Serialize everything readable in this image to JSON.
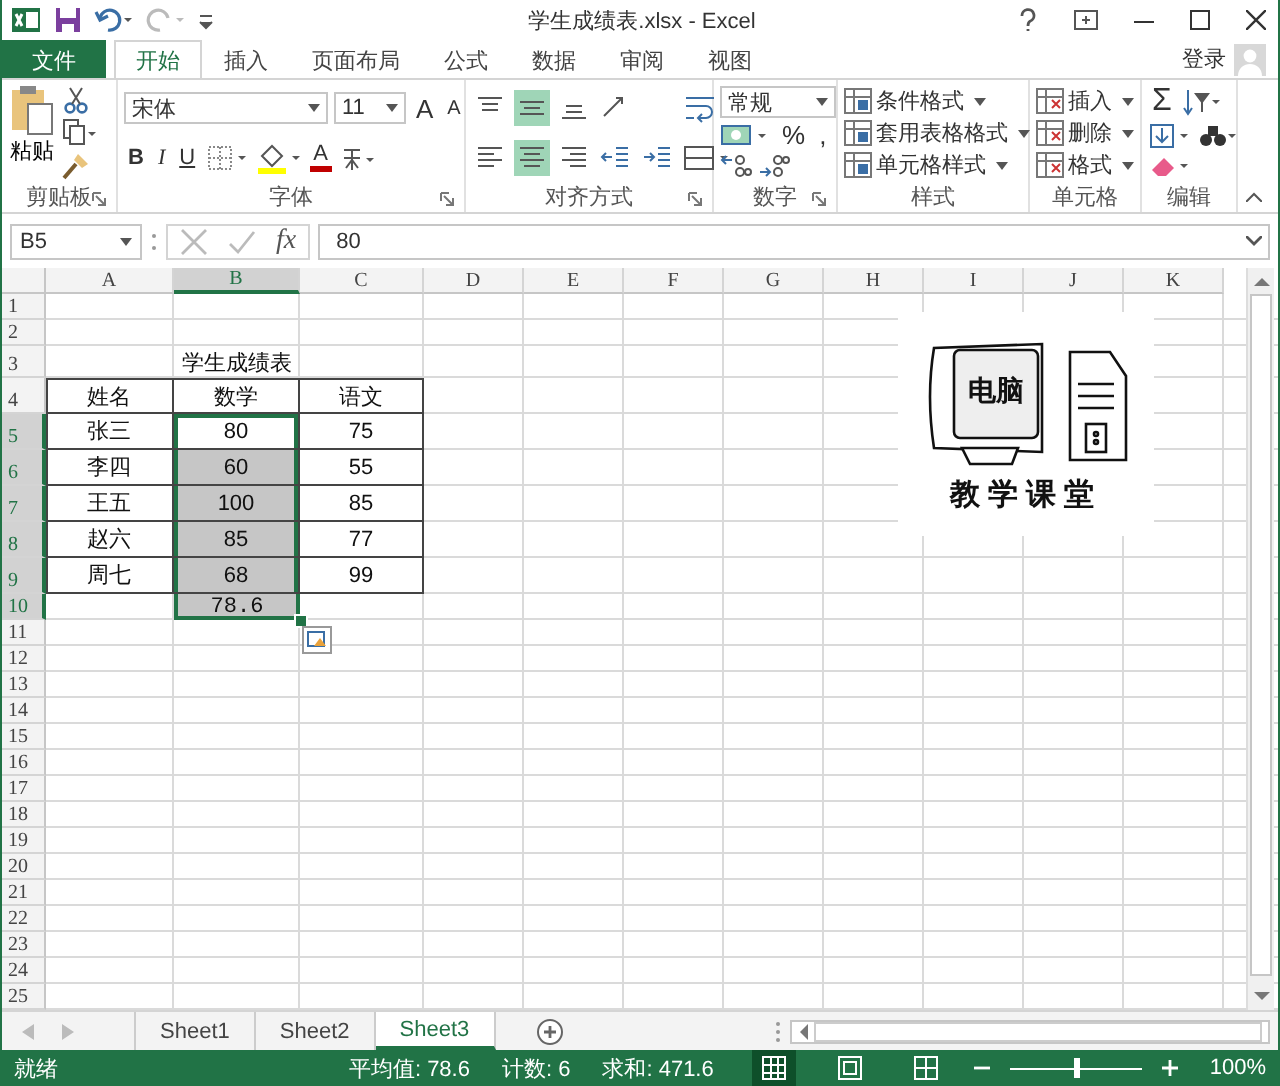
{
  "window": {
    "title": "学生成绩表.xlsx - Excel",
    "sign_in": "登录"
  },
  "ribbon_tabs": [
    {
      "label": "文件",
      "kind": "file",
      "selected": false
    },
    {
      "label": "开始",
      "kind": "tab",
      "selected": true
    },
    {
      "label": "插入",
      "kind": "tab",
      "selected": false
    },
    {
      "label": "页面布局",
      "kind": "tab",
      "selected": false
    },
    {
      "label": "公式",
      "kind": "tab",
      "selected": false
    },
    {
      "label": "数据",
      "kind": "tab",
      "selected": false
    },
    {
      "label": "审阅",
      "kind": "tab",
      "selected": false
    },
    {
      "label": "视图",
      "kind": "tab",
      "selected": false
    }
  ],
  "ribbon_groups": [
    {
      "name": "剪贴板",
      "kind": "clipboard",
      "paste": "粘贴"
    },
    {
      "name": "字体",
      "kind": "font",
      "font": "宋体",
      "size": "11",
      "grow": "A",
      "shrink": "A",
      "bold": "B",
      "italic": "I",
      "underline": "U",
      "font_color": "A"
    },
    {
      "name": "对齐方式",
      "kind": "alignment",
      "buttons": [
        {
          "kind": "top",
          "on": false
        },
        {
          "kind": "middle",
          "on": true
        },
        {
          "kind": "bottom",
          "on": false
        },
        {
          "kind": "orientation",
          "on": false
        },
        {
          "kind": "left",
          "on": false
        },
        {
          "kind": "center",
          "on": true
        },
        {
          "kind": "right",
          "on": false
        },
        {
          "kind": "outdent",
          "on": false
        },
        {
          "kind": "indent",
          "on": false
        }
      ]
    },
    {
      "name": "数字",
      "kind": "number",
      "format": "常规",
      "percent": "%",
      "comma": ","
    },
    {
      "name": "样式",
      "kind": "styles",
      "items": [
        "条件格式",
        "套用表格格式",
        "单元格样式"
      ]
    },
    {
      "name": "单元格",
      "kind": "cells",
      "items": [
        "插入",
        "删除",
        "格式"
      ]
    },
    {
      "name": "编辑",
      "kind": "editing",
      "sum": "Σ"
    }
  ],
  "formula_bar": {
    "name_box": "B5",
    "function": "fx",
    "value": "80"
  },
  "columns": [
    {
      "label": "A",
      "selected": false
    },
    {
      "label": "B",
      "selected": true
    },
    {
      "label": "C",
      "selected": false
    },
    {
      "label": "D",
      "selected": false
    },
    {
      "label": "E",
      "selected": false
    },
    {
      "label": "F",
      "selected": false
    },
    {
      "label": "G",
      "selected": false
    },
    {
      "label": "H",
      "selected": false
    },
    {
      "label": "I",
      "selected": false
    },
    {
      "label": "J",
      "selected": false
    },
    {
      "label": "K",
      "selected": false
    }
  ],
  "rows": [
    {
      "label": "1",
      "selected": false
    },
    {
      "label": "2",
      "selected": false
    },
    {
      "label": "3",
      "selected": false
    },
    {
      "label": "4",
      "selected": false
    },
    {
      "label": "5",
      "selected": true
    },
    {
      "label": "6",
      "selected": true
    },
    {
      "label": "7",
      "selected": true
    },
    {
      "label": "8",
      "selected": true
    },
    {
      "label": "9",
      "selected": true
    },
    {
      "label": "10",
      "selected": true
    },
    {
      "label": "11",
      "selected": false
    },
    {
      "label": "12",
      "selected": false
    },
    {
      "label": "13",
      "selected": false
    },
    {
      "label": "14",
      "selected": false
    },
    {
      "label": "15",
      "selected": false
    },
    {
      "label": "16",
      "selected": false
    },
    {
      "label": "17",
      "selected": false
    },
    {
      "label": "18",
      "selected": false
    },
    {
      "label": "19",
      "selected": false
    },
    {
      "label": "20",
      "selected": false
    },
    {
      "label": "21",
      "selected": false
    },
    {
      "label": "22",
      "selected": false
    },
    {
      "label": "23",
      "selected": false
    },
    {
      "label": "24",
      "selected": false
    },
    {
      "label": "25",
      "selected": false
    }
  ],
  "table": {
    "title": "学生成绩表",
    "header": [
      "姓名",
      "数学",
      "语文"
    ],
    "rows": [
      {
        "cells": [
          {
            "text": "张三",
            "selected": false
          },
          {
            "text": "80",
            "selected": true,
            "active": true
          },
          {
            "text": "75",
            "selected": false
          }
        ]
      },
      {
        "cells": [
          {
            "text": "李四",
            "selected": false
          },
          {
            "text": "60",
            "selected": true,
            "active": false
          },
          {
            "text": "55",
            "selected": false
          }
        ]
      },
      {
        "cells": [
          {
            "text": "王五",
            "selected": false
          },
          {
            "text": "100",
            "selected": true,
            "active": false
          },
          {
            "text": "85",
            "selected": false
          }
        ]
      },
      {
        "cells": [
          {
            "text": "赵六",
            "selected": false
          },
          {
            "text": "85",
            "selected": true,
            "active": false
          },
          {
            "text": "77",
            "selected": false
          }
        ]
      },
      {
        "cells": [
          {
            "text": "周七",
            "selected": false
          },
          {
            "text": "68",
            "selected": true,
            "active": false
          },
          {
            "text": "99",
            "selected": false
          }
        ]
      }
    ],
    "average": {
      "text": "78.6",
      "selected": true,
      "active": false
    }
  },
  "picture": {
    "screen_text": "电脑",
    "caption": "教学课堂"
  },
  "sheet_tabs": [
    {
      "label": "Sheet1",
      "selected": false
    },
    {
      "label": "Sheet2",
      "selected": false
    },
    {
      "label": "Sheet3",
      "selected": true
    }
  ],
  "status_bar": {
    "status": "就绪",
    "average": "平均值: 78.6",
    "count": "计数: 6",
    "sum": "求和: 471.6",
    "views": [
      {
        "kind": "normal",
        "selected": true
      },
      {
        "kind": "page-layout",
        "selected": false
      },
      {
        "kind": "page-break",
        "selected": false
      }
    ],
    "zoom_slider": {
      "level": 0.5
    },
    "zoom": "100%"
  }
}
